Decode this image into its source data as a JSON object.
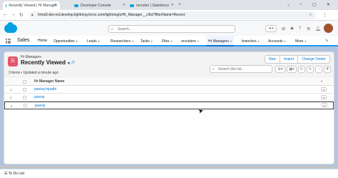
{
  "browser": {
    "tabs": [
      {
        "label": "Recently Viewed | Hr Manager",
        "active": true
      },
      {
        "label": "Developer Console",
        "active": false
      },
      {
        "label": "recruiter | Salesforce",
        "active": false
      }
    ],
    "url": "hrms5-dev-ed.develop.lightning.force.com/lightning/o/Hr_Manager__c/list?filterName=Recent"
  },
  "header": {
    "search_placeholder": "Search..."
  },
  "nav": {
    "app_name": "Sales",
    "items": [
      {
        "label": "Home",
        "caret": false
      },
      {
        "label": "Opportunities",
        "caret": true
      },
      {
        "label": "Leads",
        "caret": true
      },
      {
        "label": "Researchers",
        "caret": true
      },
      {
        "label": "Tasks",
        "caret": true
      },
      {
        "label": "Files",
        "caret": true
      },
      {
        "label": "recruiters",
        "caret": true
      },
      {
        "label": "Hr Managers",
        "caret": true
      },
      {
        "label": "branches",
        "caret": true
      },
      {
        "label": "Accounts",
        "caret": true
      },
      {
        "label": "More",
        "caret": true
      }
    ]
  },
  "list": {
    "object_label": "Hr Managers",
    "view_name": "Recently Viewed",
    "meta": "3 items • Updated a minute ago",
    "buttons": [
      "New",
      "Import",
      "Change Owner"
    ],
    "search_placeholder": "Search this list...",
    "column_header": "Hr Manager Name",
    "rows": [
      {
        "num": "1",
        "name": "pankaj tripathi"
      },
      {
        "num": "2",
        "name": "jasevp"
      },
      {
        "num": "3",
        "name": "jasevp"
      }
    ]
  },
  "utility": {
    "todo_label": "To Do List"
  },
  "colors": {
    "brand": "#00a1e0",
    "accent": "#0176d3",
    "object_icon": "#e3566b"
  }
}
